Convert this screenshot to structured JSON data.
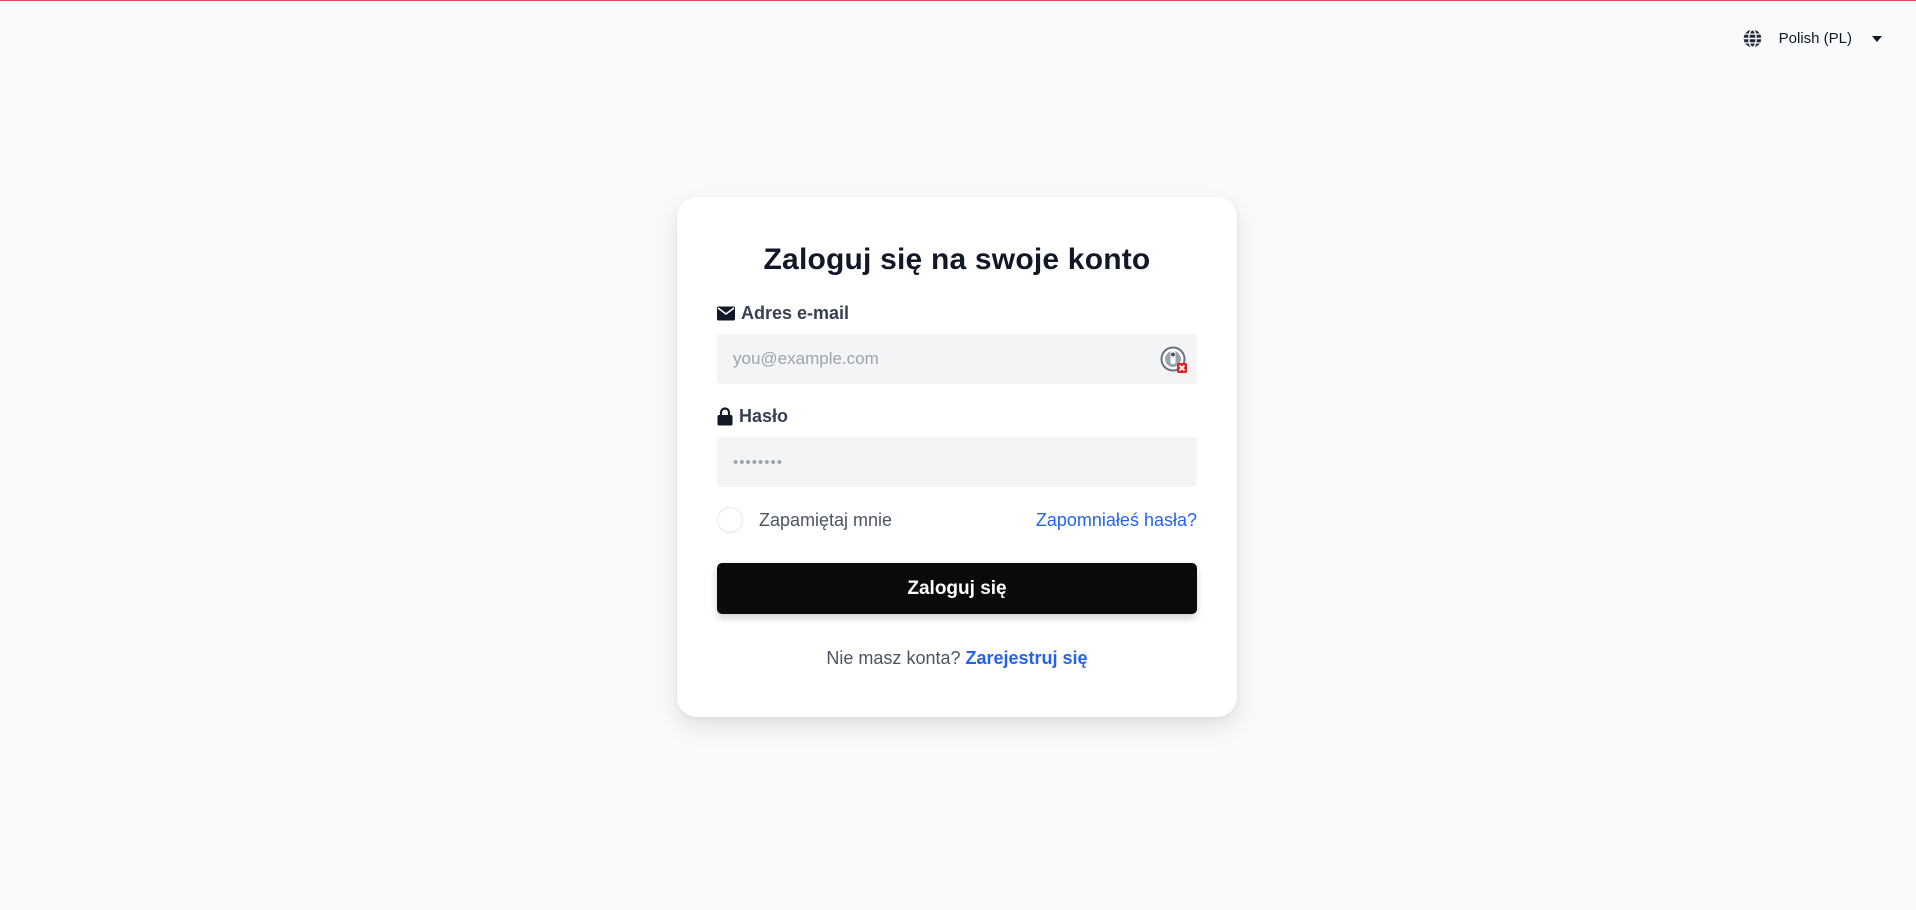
{
  "language": {
    "label": "Polish (PL)",
    "icon": "globe-icon",
    "dropdown_icon": "caret-down-icon"
  },
  "login": {
    "title": "Zaloguj się na swoje konto",
    "email": {
      "label": "Adres e-mail",
      "icon": "envelope-icon",
      "placeholder": "you@example.com",
      "value": ""
    },
    "password": {
      "label": "Hasło",
      "icon": "lock-icon",
      "placeholder": "••••••••",
      "value": ""
    },
    "remember_label": "Zapamiętaj mnie",
    "remember_checked": false,
    "forgot_link": "Zapomniałeś hasła?",
    "submit_label": "Zaloguj się",
    "signup_prompt": "Nie masz konta?",
    "signup_link": "Zarejestruj się"
  },
  "colors": {
    "background": "#f9fafb",
    "card": "#ffffff",
    "button": "#0a0a0c",
    "link": "#2563eb",
    "input_bg": "#f3f4f6"
  }
}
